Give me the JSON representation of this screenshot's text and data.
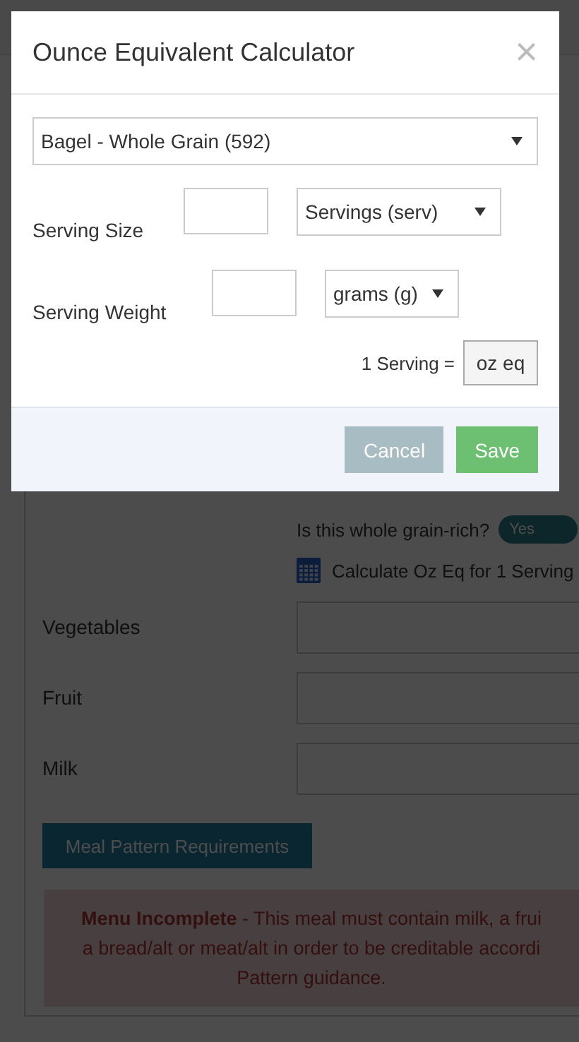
{
  "dialog": {
    "title": "Ounce Equivalent Calculator",
    "close": "×",
    "food_select": {
      "value": "Bagel - Whole Grain (592)"
    },
    "rows": [
      {
        "label": "Serving Size",
        "unit": "Servings (serv)"
      },
      {
        "label": "Serving Weight",
        "unit": "grams (g)"
      }
    ],
    "result": {
      "label": "1 Serving =",
      "unit": "oz eq"
    },
    "buttons": [
      {
        "label": "Cancel",
        "kind": "cancel"
      },
      {
        "label": "Save",
        "kind": "save"
      }
    ]
  },
  "page": {
    "whole_grain": {
      "question": "Is this whole grain-rich?",
      "toggle": {
        "label": "Yes",
        "on": true
      }
    },
    "calculate_link": "Calculate Oz Eq for 1 Serving",
    "components": [
      {
        "label": "Vegetables"
      },
      {
        "label": "Fruit"
      },
      {
        "label": "Milk"
      }
    ],
    "requirements_button": "Meal Pattern Requirements",
    "alert": {
      "lines": [
        "**Menu Incomplete** - This meal must contain milk, a frui",
        "a bread/alt or meat/alt in order to be creditable accordi",
        "Pattern guidance."
      ]
    }
  }
}
